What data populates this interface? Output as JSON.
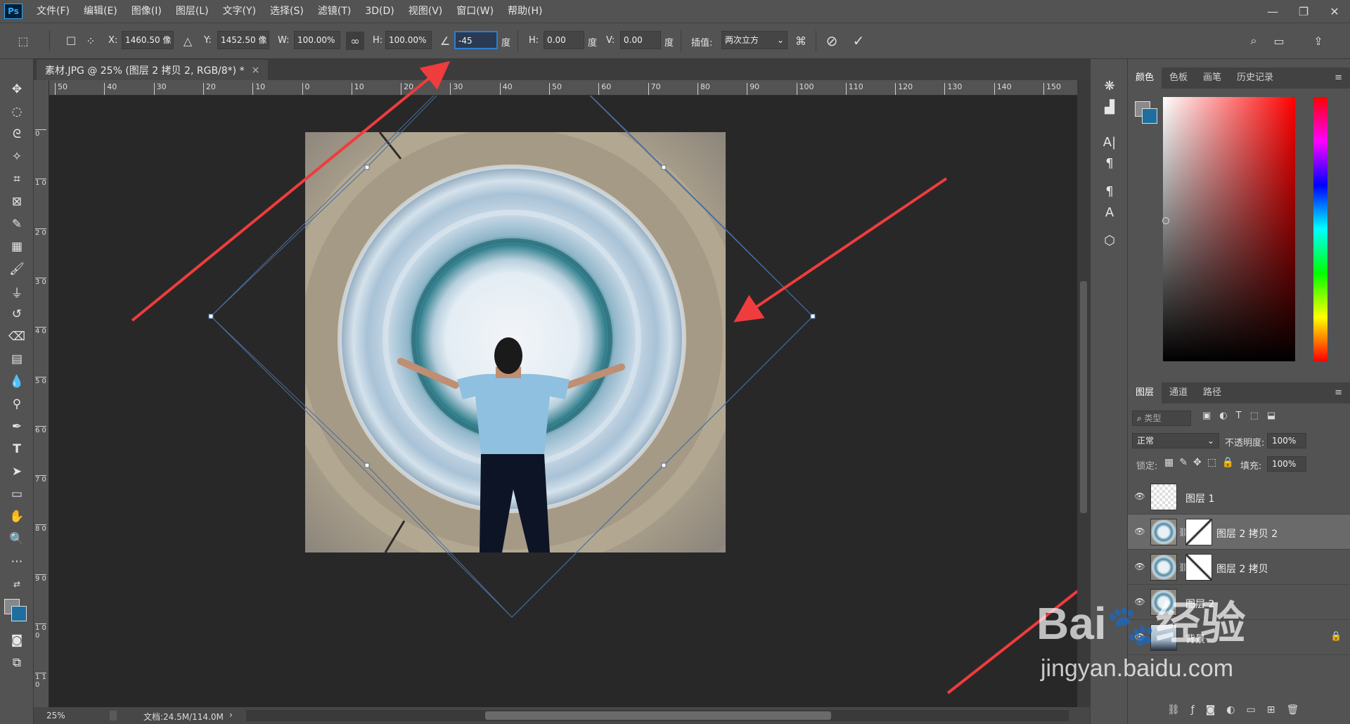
{
  "app": {
    "logo": "Ps"
  },
  "menu": {
    "items": [
      "文件(F)",
      "编辑(E)",
      "图像(I)",
      "图层(L)",
      "文字(Y)",
      "选择(S)",
      "滤镜(T)",
      "3D(D)",
      "视图(V)",
      "窗口(W)",
      "帮助(H)"
    ]
  },
  "window_controls": {
    "minimize": "—",
    "restore": "❐",
    "close": "✕"
  },
  "options": {
    "x_label": "X:",
    "x_value": "1460.50 像",
    "y_label": "Y:",
    "y_value": "1452.50 像",
    "w_label": "W:",
    "w_value": "100.00%",
    "h_label": "H:",
    "h_value": "100.00%",
    "angle_value": "-45",
    "angle_unit": "度",
    "hskew_label": "H:",
    "hskew_value": "0.00",
    "hskew_unit": "度",
    "vskew_label": "V:",
    "vskew_value": "0.00",
    "vskew_unit": "度",
    "interp_label": "插值:",
    "interp_value": "两次立方"
  },
  "document": {
    "tab_title": "素材.JPG @ 25% (图层 2 拷贝 2, RGB/8*) *",
    "close": "×"
  },
  "ruler": {
    "h_ticks": [
      "50",
      "40",
      "30",
      "20",
      "10",
      "0",
      "10",
      "20",
      "30",
      "40",
      "50",
      "60",
      "70",
      "80",
      "90",
      "100",
      "110",
      "120",
      "130",
      "140",
      "150"
    ],
    "v_ticks": [
      "0",
      "1 0",
      "2 0",
      "3 0",
      "4 0",
      "5 0",
      "6 0",
      "7 0",
      "8 0",
      "9 0",
      "1 0 0",
      "1 1 0"
    ]
  },
  "status": {
    "zoom": "25%",
    "doc_info": "文档:24.5M/114.0M",
    "arrow": "›"
  },
  "panel_color": {
    "tabs": [
      "颜色",
      "色板",
      "画笔",
      "历史记录"
    ],
    "active": 0
  },
  "panel_layers": {
    "tabs": [
      "图层",
      "通道",
      "路径"
    ],
    "active": 0,
    "filter_placeholder": "类型",
    "blend_mode": "正常",
    "opacity_label": "不透明度:",
    "opacity_value": "100%",
    "lock_label": "锁定:",
    "fill_label": "填充:",
    "fill_value": "100%",
    "layers": [
      {
        "name": "图层 1",
        "visible": true,
        "selected": false
      },
      {
        "name": "图层 2 拷贝 2",
        "visible": true,
        "selected": true
      },
      {
        "name": "图层 2 拷贝",
        "visible": true,
        "selected": false
      },
      {
        "name": "图层 2",
        "visible": true,
        "selected": false
      },
      {
        "name": "背景",
        "visible": true,
        "selected": false
      }
    ]
  },
  "watermark": {
    "brand": "Bai",
    "brand2": "经验",
    "url": "jingyan.baidu.com"
  },
  "colors": {
    "accent_arrow": "#f03c3c",
    "selection": "#2d7fd1",
    "panel_bg": "#535353",
    "canvas_bg": "#282828"
  }
}
